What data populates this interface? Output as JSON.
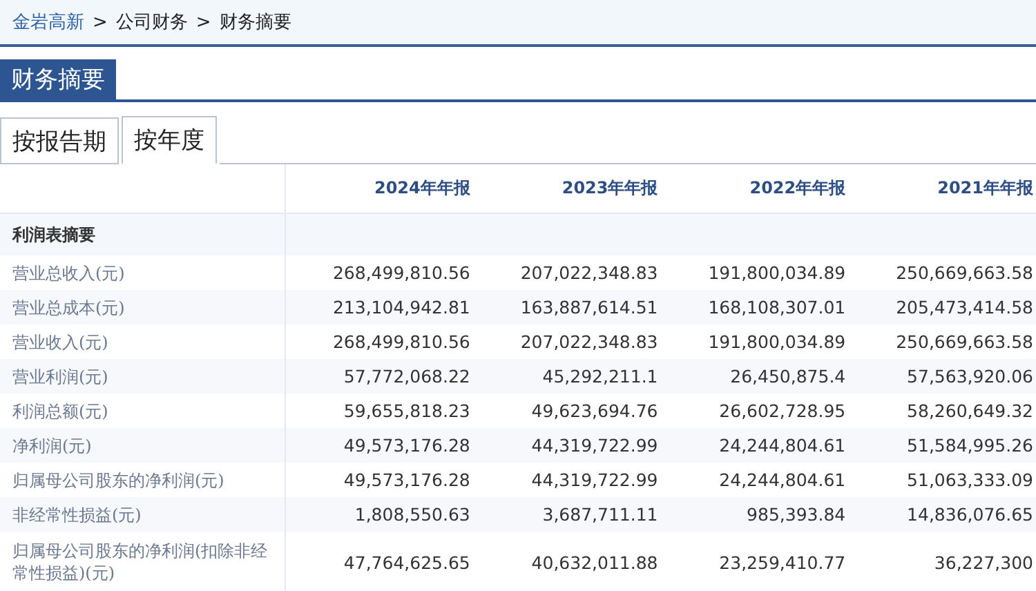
{
  "breadcrumb": [
    {
      "label": "金岩高新",
      "kind": "link"
    },
    {
      "label": ">",
      "kind": "separator"
    },
    {
      "label": "公司财务",
      "kind": "text"
    },
    {
      "label": ">",
      "kind": "separator"
    },
    {
      "label": "财务摘要",
      "kind": "text"
    }
  ],
  "section_title": "财务摘要",
  "tabs": [
    {
      "label": "按报告期",
      "selected": false
    },
    {
      "label": "按年度",
      "selected": true
    }
  ],
  "table": {
    "columns": [
      "2024年年报",
      "2023年年报",
      "2022年年报",
      "2021年年报"
    ],
    "group_label": "利润表摘要",
    "rows": [
      {
        "label": "营业总收入(元)",
        "values": [
          "268,499,810.56",
          "207,022,348.83",
          "191,800,034.89",
          "250,669,663.58"
        ]
      },
      {
        "label": "营业总成本(元)",
        "values": [
          "213,104,942.81",
          "163,887,614.51",
          "168,108,307.01",
          "205,473,414.58"
        ]
      },
      {
        "label": "营业收入(元)",
        "values": [
          "268,499,810.56",
          "207,022,348.83",
          "191,800,034.89",
          "250,669,663.58"
        ]
      },
      {
        "label": "营业利润(元)",
        "values": [
          "57,772,068.22",
          "45,292,211.1",
          "26,450,875.4",
          "57,563,920.06"
        ]
      },
      {
        "label": "利润总额(元)",
        "values": [
          "59,655,818.23",
          "49,623,694.76",
          "26,602,728.95",
          "58,260,649.32"
        ]
      },
      {
        "label": "净利润(元)",
        "values": [
          "49,573,176.28",
          "44,319,722.99",
          "24,244,804.61",
          "51,584,995.26"
        ]
      },
      {
        "label": "归属母公司股东的净利润(元)",
        "values": [
          "49,573,176.28",
          "44,319,722.99",
          "24,244,804.61",
          "51,063,333.09"
        ]
      },
      {
        "label": "非经常性损益(元)",
        "values": [
          "1,808,550.63",
          "3,687,711.11",
          "985,393.84",
          "14,836,076.65"
        ]
      },
      {
        "label": "归属母公司股东的净利润(扣除非经常性损益)(元)",
        "values": [
          "47,764,625.65",
          "40,632,011.88",
          "23,259,410.77",
          "36,227,300"
        ]
      }
    ]
  }
}
